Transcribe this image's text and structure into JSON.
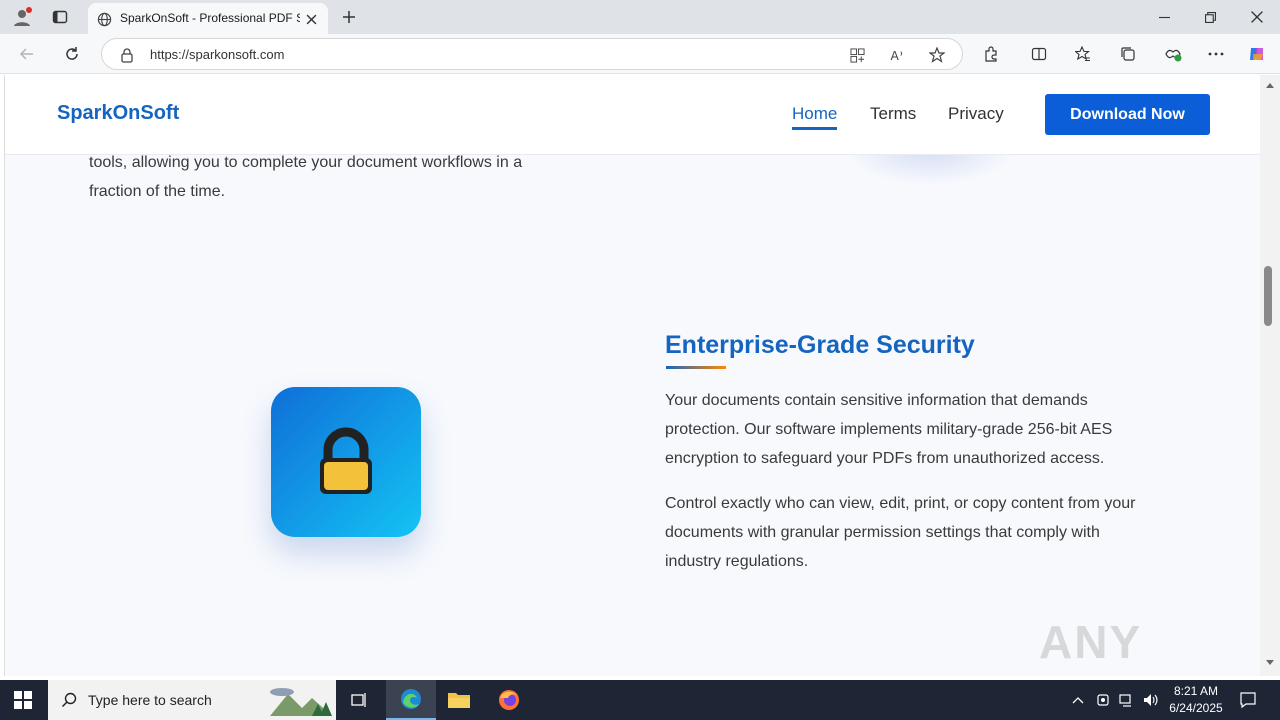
{
  "browser": {
    "tab_title": "SparkOnSoft - Professional PDF S",
    "url": "https://sparkonsoft.com"
  },
  "site": {
    "logo": "SparkOnSoft",
    "nav": {
      "home": "Home",
      "terms": "Terms",
      "privacy": "Privacy"
    },
    "download_button": "Download Now"
  },
  "content": {
    "prev_line1": "tools, allowing you to complete your document workflows in a",
    "prev_line2": "fraction of the time.",
    "security_heading": "Enterprise-Grade Security",
    "para1_l1": "Your documents contain sensitive information that demands",
    "para1_l2": "protection. Our software implements military-grade 256-bit AES",
    "para1_l3": "encryption to safeguard your PDFs from unauthorized access.",
    "para2_l1": "Control exactly who can view, edit, print, or copy content from your",
    "para2_l2": "documents with granular permission settings that comply with",
    "para2_l3": "industry regulations."
  },
  "watermark": "ANY RUN",
  "taskbar": {
    "search_placeholder": "Type here to search",
    "time": "8:21 AM",
    "date": "6/24/2025"
  },
  "colors": {
    "brand": "#1565c0",
    "button": "#0b5ed7",
    "accent": "#ff8a00"
  }
}
